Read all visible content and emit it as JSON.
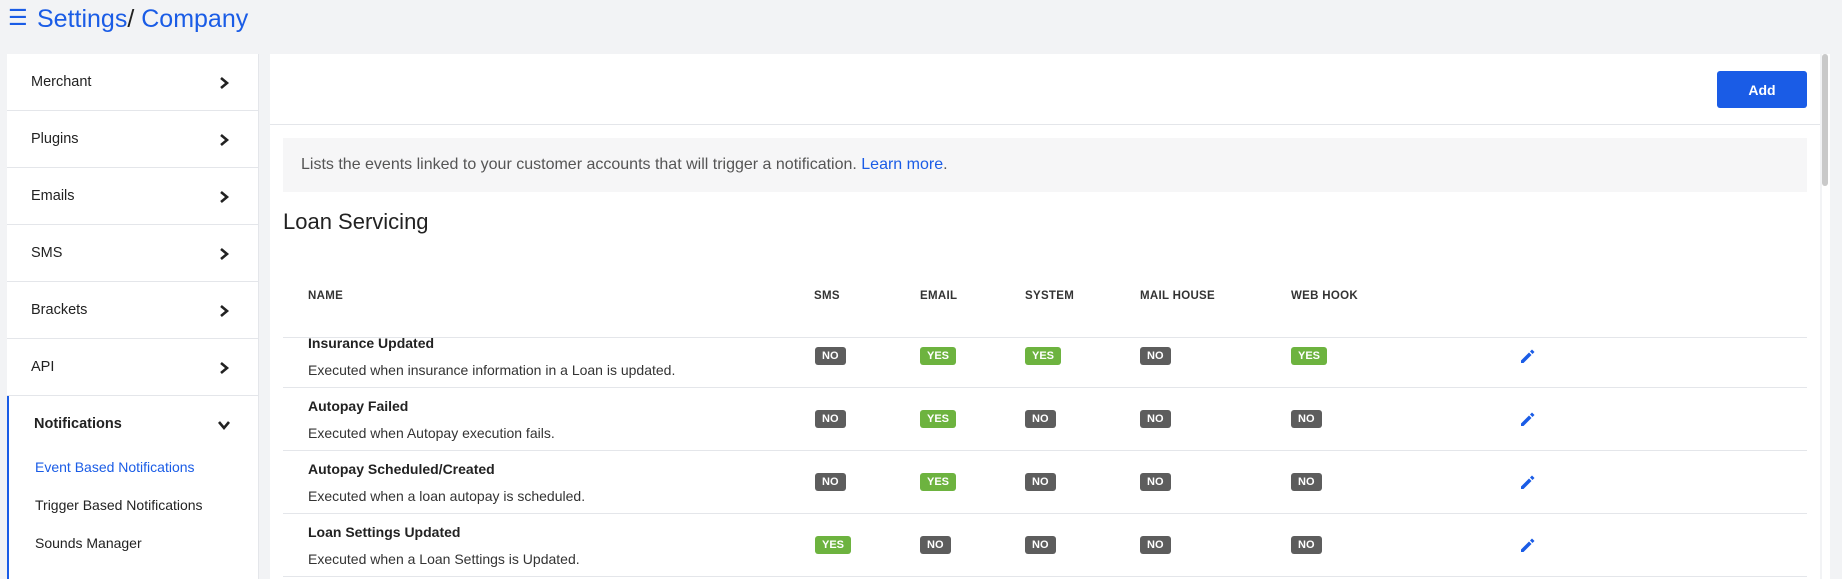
{
  "breadcrumb": {
    "root": "Settings",
    "separator": "/",
    "current": "Company"
  },
  "sidebar": {
    "items": [
      {
        "label": "Merchant",
        "icon": "chevron-right-icon"
      },
      {
        "label": "Plugins",
        "icon": "chevron-right-icon"
      },
      {
        "label": "Emails",
        "icon": "chevron-right-icon"
      },
      {
        "label": "SMS",
        "icon": "chevron-right-icon"
      },
      {
        "label": "Brackets",
        "icon": "chevron-right-icon"
      },
      {
        "label": "API",
        "icon": "chevron-right-icon"
      }
    ],
    "active": {
      "label": "Notifications",
      "icon": "chevron-down-icon",
      "subitems": [
        {
          "label": "Event Based Notifications",
          "current": true
        },
        {
          "label": "Trigger Based Notifications",
          "current": false
        },
        {
          "label": "Sounds Manager",
          "current": false
        }
      ]
    }
  },
  "toolbar": {
    "add_label": "Add"
  },
  "info": {
    "text": "Lists the events linked to your customer accounts that will trigger a notification. ",
    "link": "Learn more",
    "suffix": "."
  },
  "section": {
    "title": "Loan Servicing"
  },
  "table": {
    "headers": [
      "NAME",
      "SMS",
      "EMAIL",
      "SYSTEM",
      "MAIL HOUSE",
      "WEB HOOK"
    ],
    "rows": [
      {
        "name": "Insurance Updated",
        "desc": "Executed when insurance information in a Loan is updated.",
        "sms": "NO",
        "email": "YES",
        "system": "YES",
        "mail_house": "NO",
        "web_hook": "YES"
      },
      {
        "name": "Autopay Failed",
        "desc": "Executed when Autopay execution fails.",
        "sms": "NO",
        "email": "YES",
        "system": "NO",
        "mail_house": "NO",
        "web_hook": "NO"
      },
      {
        "name": "Autopay Scheduled/Created",
        "desc": "Executed when a loan autopay is scheduled.",
        "sms": "NO",
        "email": "YES",
        "system": "NO",
        "mail_house": "NO",
        "web_hook": "NO"
      },
      {
        "name": "Loan Settings Updated",
        "desc": "Executed when a Loan Settings is Updated.",
        "sms": "YES",
        "email": "NO",
        "system": "NO",
        "mail_house": "NO",
        "web_hook": "NO"
      }
    ]
  },
  "colors": {
    "accent": "#1a5ce6",
    "yes": "#6db33f",
    "no": "#5d5d5d"
  }
}
